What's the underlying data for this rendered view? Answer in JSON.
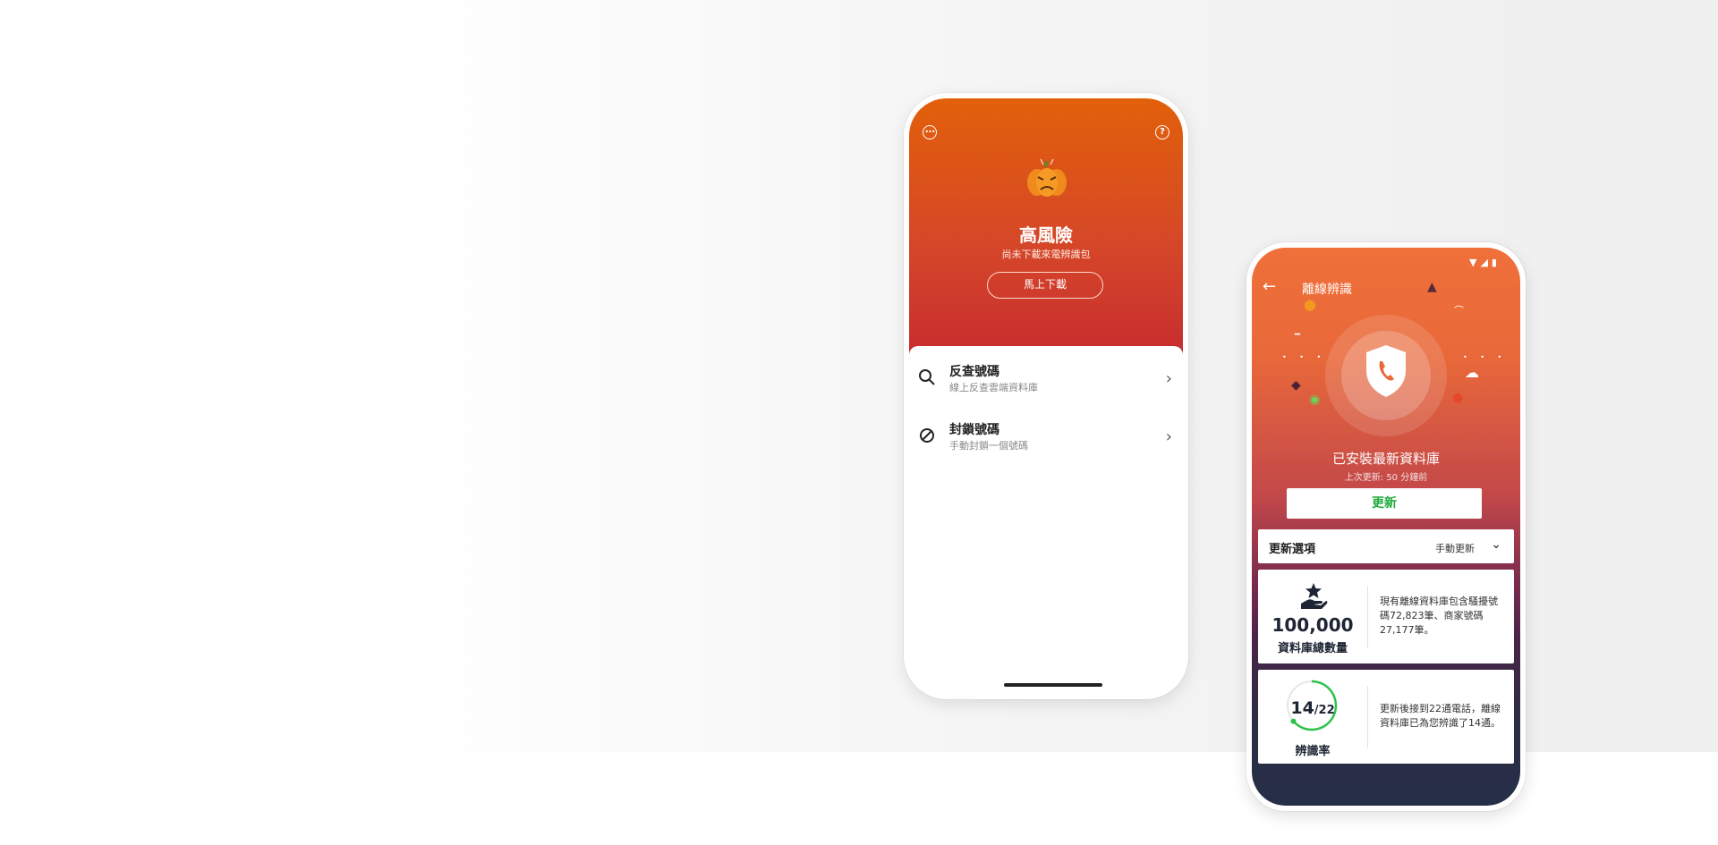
{
  "phone1": {
    "title": "高風險",
    "subtitle": "尚未下載來電辨識包",
    "download_button": "馬上下載",
    "menu": [
      {
        "label": "反查號碼",
        "sub": "線上反查雲端資料庫"
      },
      {
        "label": "封鎖號碼",
        "sub": "手動封鎖一個號碼"
      }
    ]
  },
  "phone2": {
    "header_title": "離線辨識",
    "status": "已安裝最新資料庫",
    "last_update": "上次更新: 50 分鐘前",
    "update_button": "更新",
    "options": {
      "label": "更新選項",
      "value": "手動更新"
    },
    "db_card": {
      "number": "100,000",
      "label": "資料庫總數量",
      "desc": "現有離線資料庫包含騷擾號碼72,823筆、商家號碼27,177筆。"
    },
    "rate_card": {
      "num": "14",
      "denom": "/22",
      "label": "辨識率",
      "desc": "更新後接到22通電話，離線資料庫已為您辨識了14通。"
    }
  },
  "colors": {
    "accent_orange": "#e2600a",
    "danger_red": "#c72c2e",
    "update_green": "#1faa3c",
    "dark_navy": "#262f48"
  },
  "icons": [
    "more-icon",
    "help-icon",
    "pumpkin-icon",
    "search-icon",
    "block-icon",
    "chevron-right-icon",
    "back-arrow-icon",
    "shield-phone-icon",
    "chevron-down-icon",
    "hand-star-icon"
  ]
}
